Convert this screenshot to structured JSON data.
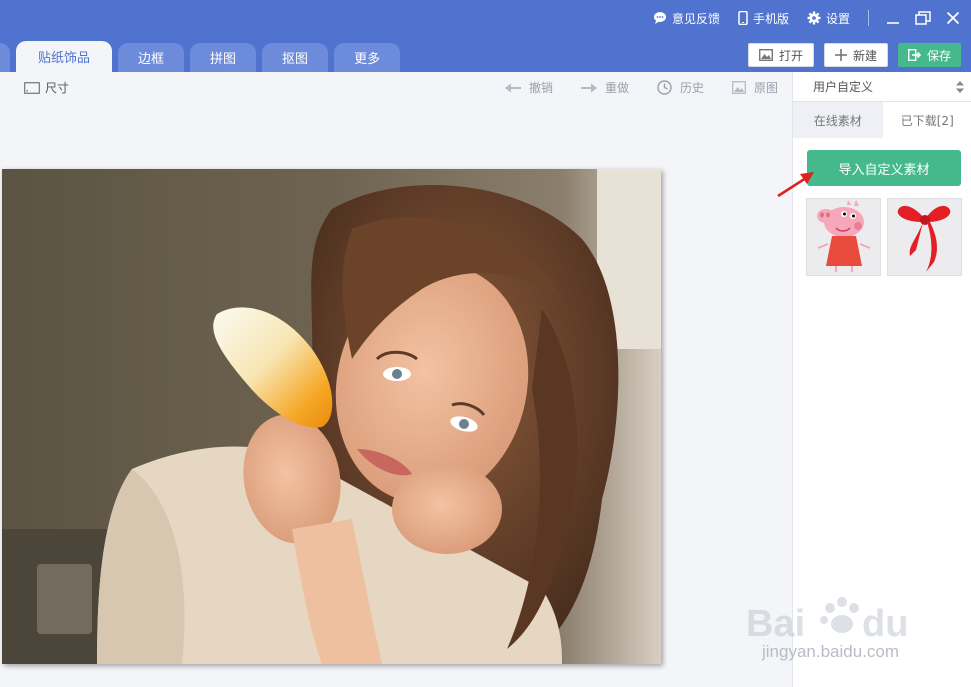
{
  "top_links": {
    "feedback": "意见反馈",
    "mobile": "手机版",
    "settings": "设置"
  },
  "tabs": [
    {
      "label": "贴纸饰品",
      "active": true
    },
    {
      "label": "边框",
      "active": false
    },
    {
      "label": "拼图",
      "active": false
    },
    {
      "label": "抠图",
      "active": false
    },
    {
      "label": "更多",
      "active": false
    }
  ],
  "actions": {
    "open": "打开",
    "new": "新建",
    "save": "保存"
  },
  "edit_tools": {
    "size": "尺寸",
    "undo": "撤销",
    "redo": "重做",
    "history": "历史",
    "original": "原图"
  },
  "panel": {
    "category_select": "用户自定义",
    "tab_online": "在线素材",
    "tab_downloaded": "已下载[2]",
    "import_button": "导入自定义素材",
    "stickers": [
      "peppa-pig-sticker",
      "red-ribbon-sticker"
    ]
  },
  "watermark": {
    "url": "jingyan.baidu.com"
  },
  "colors": {
    "brand": "#4f73cf",
    "accent": "#45b98c",
    "annotation": "#e02020"
  }
}
